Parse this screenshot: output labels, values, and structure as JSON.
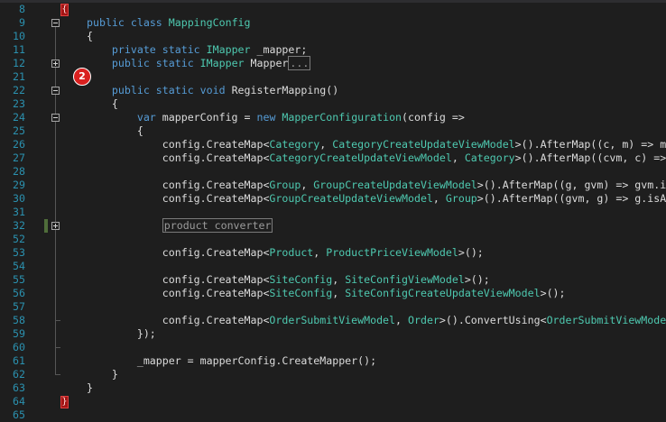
{
  "editor": {
    "callout_badge": "2",
    "lines": [
      {
        "n": "8",
        "fold": "",
        "brace": "{",
        "segs": []
      },
      {
        "n": "9",
        "fold": "minus",
        "segs": [
          {
            "t": "public",
            "c": "kw"
          },
          {
            "t": " ",
            "c": "pl"
          },
          {
            "t": "class",
            "c": "kw"
          },
          {
            "t": " ",
            "c": "pl"
          },
          {
            "t": "MappingConfig",
            "c": "ty"
          }
        ]
      },
      {
        "n": "10",
        "fold": "",
        "segs": [
          {
            "t": "{",
            "c": "pl"
          }
        ]
      },
      {
        "n": "11",
        "fold": "",
        "segs": [
          {
            "t": "    ",
            "c": "pl"
          },
          {
            "t": "private",
            "c": "kw"
          },
          {
            "t": " ",
            "c": "pl"
          },
          {
            "t": "static",
            "c": "kw"
          },
          {
            "t": " ",
            "c": "pl"
          },
          {
            "t": "IMapper",
            "c": "ty"
          },
          {
            "t": " _mapper;",
            "c": "pl"
          }
        ]
      },
      {
        "n": "12",
        "fold": "plus",
        "segs": [
          {
            "t": "    ",
            "c": "pl"
          },
          {
            "t": "public",
            "c": "kw"
          },
          {
            "t": " ",
            "c": "pl"
          },
          {
            "t": "static",
            "c": "kw"
          },
          {
            "t": " ",
            "c": "pl"
          },
          {
            "t": "IMapper",
            "c": "ty"
          },
          {
            "t": " Mapper",
            "c": "pl"
          },
          {
            "t": "...",
            "c": "collapsed"
          }
        ]
      },
      {
        "n": "21",
        "fold": "",
        "segs": []
      },
      {
        "n": "22",
        "fold": "minus",
        "segs": [
          {
            "t": "    ",
            "c": "pl"
          },
          {
            "t": "public",
            "c": "kw"
          },
          {
            "t": " ",
            "c": "pl"
          },
          {
            "t": "static",
            "c": "kw"
          },
          {
            "t": " ",
            "c": "pl"
          },
          {
            "t": "void",
            "c": "kw"
          },
          {
            "t": " RegisterMapping()",
            "c": "pl"
          }
        ]
      },
      {
        "n": "23",
        "fold": "",
        "segs": [
          {
            "t": "    {",
            "c": "pl"
          }
        ]
      },
      {
        "n": "24",
        "fold": "minus",
        "segs": [
          {
            "t": "        ",
            "c": "pl"
          },
          {
            "t": "var",
            "c": "kw"
          },
          {
            "t": " mapperConfig = ",
            "c": "pl"
          },
          {
            "t": "new",
            "c": "kw"
          },
          {
            "t": " ",
            "c": "pl"
          },
          {
            "t": "MapperConfiguration",
            "c": "ty"
          },
          {
            "t": "(config =>",
            "c": "pl"
          }
        ]
      },
      {
        "n": "25",
        "fold": "",
        "segs": [
          {
            "t": "        {",
            "c": "pl"
          }
        ]
      },
      {
        "n": "26",
        "fold": "",
        "segs": [
          {
            "t": "            config.CreateMap<",
            "c": "pl"
          },
          {
            "t": "Category",
            "c": "ty"
          },
          {
            "t": ", ",
            "c": "pl"
          },
          {
            "t": "CategoryCreateUpdateViewModel",
            "c": "ty"
          },
          {
            "t": ">().AfterMap((c, m) => m",
            "c": "pl"
          }
        ]
      },
      {
        "n": "27",
        "fold": "",
        "segs": [
          {
            "t": "            config.CreateMap<",
            "c": "pl"
          },
          {
            "t": "CategoryCreateUpdateViewModel",
            "c": "ty"
          },
          {
            "t": ", ",
            "c": "pl"
          },
          {
            "t": "Category",
            "c": "ty"
          },
          {
            "t": ">().AfterMap((cvm, c) =>",
            "c": "pl"
          }
        ]
      },
      {
        "n": "28",
        "fold": "",
        "segs": []
      },
      {
        "n": "29",
        "fold": "",
        "segs": [
          {
            "t": "            config.CreateMap<",
            "c": "pl"
          },
          {
            "t": "Group",
            "c": "ty"
          },
          {
            "t": ", ",
            "c": "pl"
          },
          {
            "t": "GroupCreateUpdateViewModel",
            "c": "ty"
          },
          {
            "t": ">().AfterMap((g, gvm) => gvm.i",
            "c": "pl"
          }
        ]
      },
      {
        "n": "30",
        "fold": "",
        "segs": [
          {
            "t": "            config.CreateMap<",
            "c": "pl"
          },
          {
            "t": "GroupCreateUpdateViewModel",
            "c": "ty"
          },
          {
            "t": ", ",
            "c": "pl"
          },
          {
            "t": "Group",
            "c": "ty"
          },
          {
            "t": ">().AfterMap((gvm, g) => g.isA",
            "c": "pl"
          }
        ]
      },
      {
        "n": "31",
        "fold": "",
        "segs": []
      },
      {
        "n": "32",
        "fold": "plus",
        "change": true,
        "segs": [
          {
            "t": "            ",
            "c": "pl"
          },
          {
            "t": "product converter",
            "c": "collapsed"
          }
        ]
      },
      {
        "n": "52",
        "fold": "",
        "segs": []
      },
      {
        "n": "53",
        "fold": "",
        "segs": [
          {
            "t": "            config.CreateMap<",
            "c": "pl"
          },
          {
            "t": "Product",
            "c": "ty"
          },
          {
            "t": ", ",
            "c": "pl"
          },
          {
            "t": "ProductPriceViewModel",
            "c": "ty"
          },
          {
            "t": ">();",
            "c": "pl"
          }
        ]
      },
      {
        "n": "54",
        "fold": "",
        "segs": []
      },
      {
        "n": "55",
        "fold": "",
        "segs": [
          {
            "t": "            config.CreateMap<",
            "c": "pl"
          },
          {
            "t": "SiteConfig",
            "c": "ty"
          },
          {
            "t": ", ",
            "c": "pl"
          },
          {
            "t": "SiteConfigViewModel",
            "c": "ty"
          },
          {
            "t": ">();",
            "c": "pl"
          }
        ]
      },
      {
        "n": "56",
        "fold": "",
        "segs": [
          {
            "t": "            config.CreateMap<",
            "c": "pl"
          },
          {
            "t": "SiteConfig",
            "c": "ty"
          },
          {
            "t": ", ",
            "c": "pl"
          },
          {
            "t": "SiteConfigCreateUpdateViewModel",
            "c": "ty"
          },
          {
            "t": ">();",
            "c": "pl"
          }
        ]
      },
      {
        "n": "57",
        "fold": "",
        "segs": []
      },
      {
        "n": "58",
        "fold": "",
        "segs": [
          {
            "t": "            config.CreateMap<",
            "c": "pl"
          },
          {
            "t": "OrderSubmitViewModel",
            "c": "ty"
          },
          {
            "t": ", ",
            "c": "pl"
          },
          {
            "t": "Order",
            "c": "ty"
          },
          {
            "t": ">().ConvertUsing<",
            "c": "pl"
          },
          {
            "t": "OrderSubmitViewMode",
            "c": "ty"
          }
        ]
      },
      {
        "n": "59",
        "fold": "",
        "segs": [
          {
            "t": "        });",
            "c": "pl"
          }
        ]
      },
      {
        "n": "60",
        "fold": "",
        "segs": []
      },
      {
        "n": "61",
        "fold": "",
        "segs": [
          {
            "t": "        _mapper = mapperConfig.CreateMapper();",
            "c": "pl"
          }
        ]
      },
      {
        "n": "62",
        "fold": "",
        "segs": [
          {
            "t": "    }",
            "c": "pl"
          }
        ]
      },
      {
        "n": "63",
        "fold": "",
        "segs": [
          {
            "t": "}",
            "c": "pl"
          }
        ]
      },
      {
        "n": "64",
        "fold": "",
        "brace": "}",
        "segs": []
      },
      {
        "n": "65",
        "fold": "",
        "segs": []
      }
    ]
  }
}
